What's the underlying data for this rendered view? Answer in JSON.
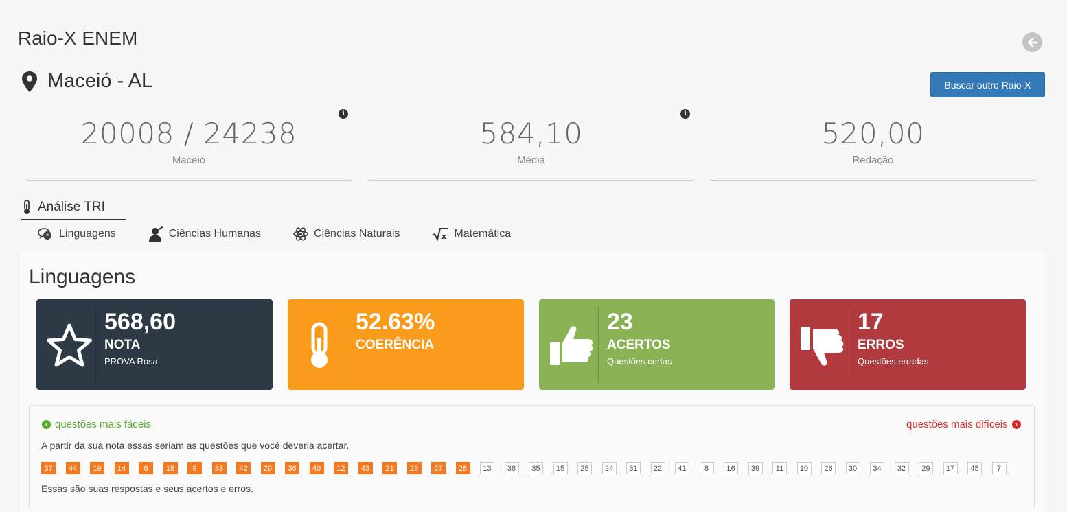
{
  "header": {
    "title": "Raio-X ENEM"
  },
  "location": {
    "name": "Maceió - AL",
    "button": "Buscar outro Raio-X"
  },
  "stats": [
    {
      "value": "20008 / 24238",
      "label": "Maceió"
    },
    {
      "value": "584,10",
      "label": "Média"
    },
    {
      "value": "520,00",
      "label": "Redação"
    }
  ],
  "tri": {
    "title": "Análise TRI"
  },
  "tabs": [
    {
      "label": "Linguagens"
    },
    {
      "label": "Ciências Humanas"
    },
    {
      "label": "Ciências Naturais"
    },
    {
      "label": "Matemática"
    }
  ],
  "section": {
    "title": "Linguagens"
  },
  "cards": [
    {
      "value": "568,60",
      "title": "NOTA",
      "subtitle": "PROVA Rosa",
      "color": "#2d3945",
      "icon": "star-icon"
    },
    {
      "value": "52.63%",
      "title": "COERÊNCIA",
      "subtitle": "",
      "color": "#fb9b1b",
      "icon": "thermometer-icon"
    },
    {
      "value": "23",
      "title": "ACERTOS",
      "subtitle": "Questões certas",
      "color": "#8ab254",
      "icon": "thumbs-up-icon"
    },
    {
      "value": "17",
      "title": "ERROS",
      "subtitle": "Questões erradas",
      "color": "#b03a3e",
      "icon": "thumbs-down-icon"
    }
  ],
  "questions": {
    "easier_link": "questões mais fáceis",
    "harder_link": "questões mais difíceis",
    "description": "A partir da sua nota essas seriam as questões que você deveria acertar.",
    "expected": [
      "37",
      "44",
      "19",
      "14",
      "6",
      "18",
      "9",
      "33",
      "42",
      "20",
      "36",
      "40",
      "12",
      "43",
      "21",
      "23",
      "27",
      "28"
    ],
    "others": [
      "13",
      "38",
      "35",
      "15",
      "25",
      "24",
      "31",
      "22",
      "41",
      "8",
      "16",
      "39",
      "11",
      "10",
      "26",
      "30",
      "34",
      "32",
      "29",
      "17",
      "45",
      "7"
    ],
    "footer": "Essas são suas respostas e seus acertos e erros."
  },
  "colors": {
    "primary": "#337ab7",
    "orange": "#f47920",
    "green": "#5cab2e",
    "red": "#d9302c"
  }
}
